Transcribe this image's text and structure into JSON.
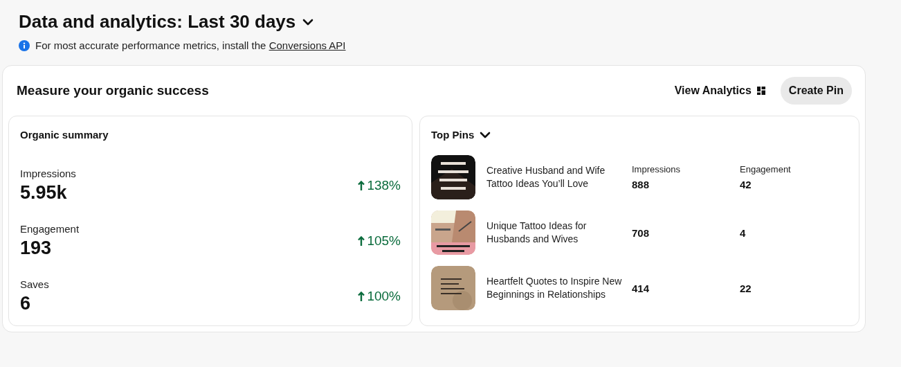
{
  "header": {
    "title": "Data and analytics: Last 30 days",
    "notice": "For most accurate performance metrics, install the",
    "notice_link": "Conversions API"
  },
  "card": {
    "title": "Measure your organic success",
    "actions": [
      {
        "kind": "link",
        "label": "View Analytics"
      },
      {
        "kind": "button",
        "label": "Create Pin"
      }
    ]
  },
  "organic_summary": {
    "title": "Organic summary",
    "metrics": [
      {
        "label": "Impressions",
        "value": "5.95k",
        "change": "138%"
      },
      {
        "label": "Engagement",
        "value": "193",
        "change": "105%"
      },
      {
        "label": "Saves",
        "value": "6",
        "change": "100%"
      }
    ]
  },
  "top_pins": {
    "title": "Top Pins",
    "columns": [
      "Impressions",
      "Engagement"
    ],
    "pins": [
      {
        "title": "Creative Husband and Wife Tattoo Ideas You’ll Love",
        "impressions": "888",
        "engagement": "42"
      },
      {
        "title": "Unique Tattoo Ideas for Husbands and Wives",
        "impressions": "708",
        "engagement": "4"
      },
      {
        "title": "Heartfelt Quotes to Inspire New Beginnings in Relationships",
        "impressions": "414",
        "engagement": "22"
      }
    ]
  }
}
